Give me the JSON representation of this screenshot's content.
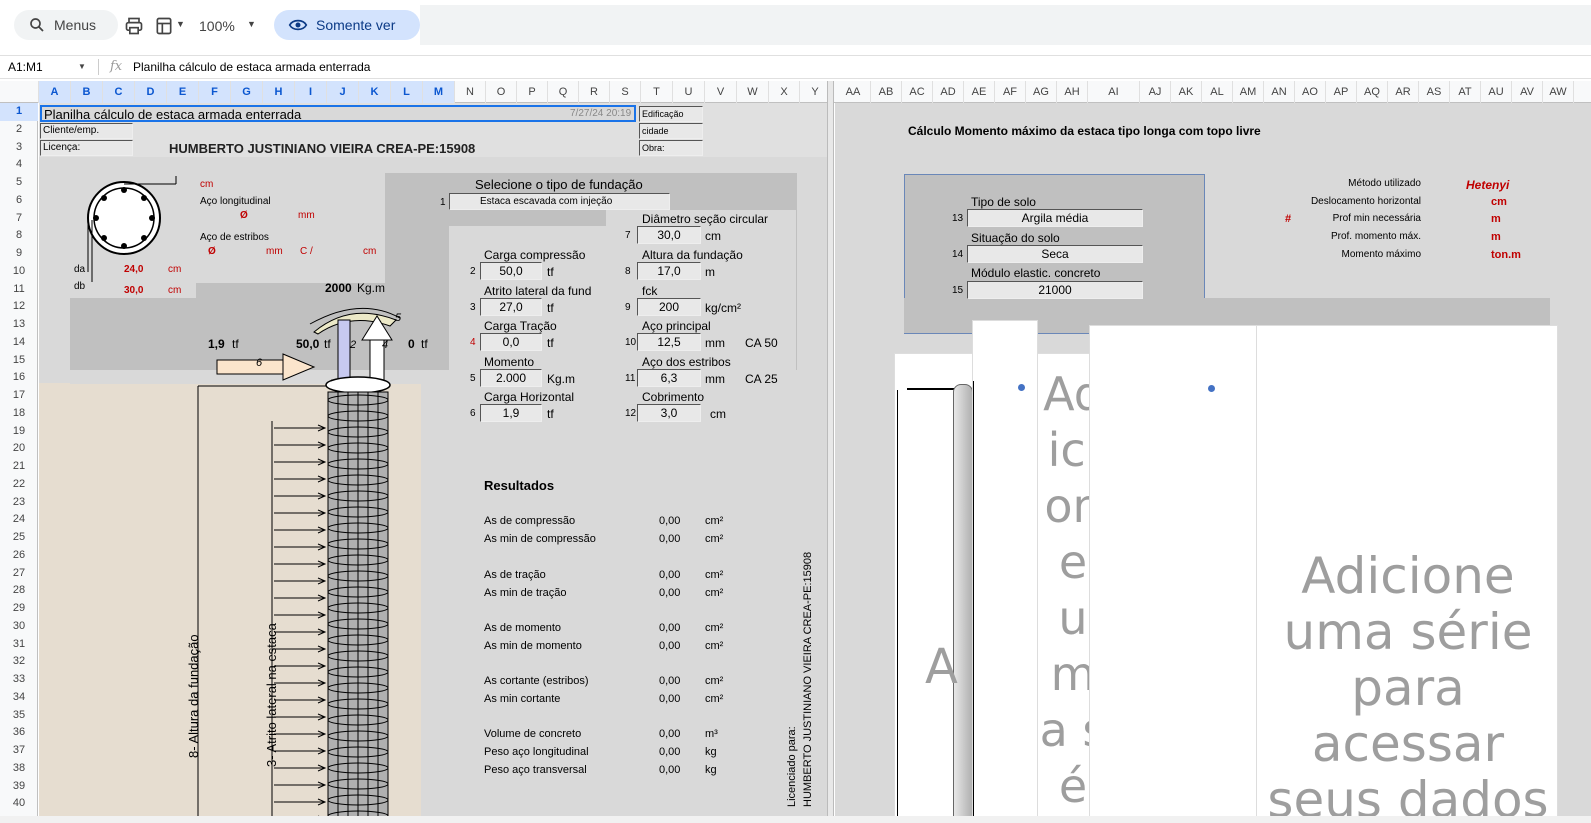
{
  "toolbar": {
    "search_label": "Menus",
    "zoom": "100%",
    "view_mode": "Somente ver"
  },
  "formula_bar": {
    "cell_ref": "A1:M1",
    "fx": "fx",
    "content": "Planilha cálculo de estaca armada enterrada"
  },
  "columns": [
    "A",
    "B",
    "C",
    "D",
    "E",
    "F",
    "G",
    "H",
    "I",
    "J",
    "K",
    "L",
    "M",
    "N",
    "O",
    "P",
    "Q",
    "R",
    "S",
    "T",
    "U",
    "V",
    "W",
    "X",
    "Y",
    "AA",
    "AB",
    "AC",
    "AD",
    "AE",
    "AF",
    "AG",
    "AH",
    "AI",
    "AJ",
    "AK",
    "AL",
    "AM",
    "AN",
    "AO",
    "AP",
    "AQ",
    "AR",
    "AS",
    "AT",
    "AU",
    "AV",
    "AW"
  ],
  "rows": [
    "1",
    "2",
    "3",
    "4",
    "5",
    "6",
    "7",
    "8",
    "9",
    "10",
    "11",
    "12",
    "13",
    "14",
    "15",
    "16",
    "17",
    "18",
    "19",
    "20",
    "21",
    "22",
    "23",
    "24",
    "25",
    "26",
    "27",
    "28",
    "29",
    "30",
    "31",
    "32",
    "33",
    "34",
    "35",
    "36",
    "37",
    "38",
    "39",
    "40"
  ],
  "sheet": {
    "title": "Planilha cálculo de estaca armada enterrada",
    "timestamp": "7/27/24 20:19",
    "edificacao": "Edificação",
    "cidade": "cidade",
    "obra": "Obra:",
    "cliente": "Cliente/emp.",
    "licenca": "Licença:",
    "licensee": "HUMBERTO JUSTINIANO VIEIRA  CREA-PE:15908",
    "section": {
      "cm": "cm",
      "aco_long": "Aço longitudinal",
      "phi1": "Ø",
      "mm1": "mm",
      "aco_estribos": "Aço de estribos",
      "phi2": "Ø",
      "mm2": "mm",
      "c": "C /",
      "cm2": "cm",
      "da": "da",
      "da_val": "24,0",
      "da_unit": "cm",
      "db": "db",
      "db_val": "30,0",
      "db_unit": "cm"
    },
    "foundation": {
      "header": "Selecione o tipo de fundação",
      "idx": "1",
      "type": "Estaca escavada com injeção"
    },
    "loads": [
      {
        "idx": "2",
        "label": "Carga compressão",
        "value": "50,0",
        "unit": "tf"
      },
      {
        "idx": "3",
        "label": "Atrito lateral da fund",
        "value": "27,0",
        "unit": "tf"
      },
      {
        "idx": "4",
        "label": "Carga Tração",
        "value": "0,0",
        "unit": "tf"
      },
      {
        "idx": "5",
        "label": "Momento",
        "value": "2.000",
        "unit": "Kg.m"
      },
      {
        "idx": "6",
        "label": "Carga Horizontal",
        "value": "1,9",
        "unit": "tf"
      }
    ],
    "params": [
      {
        "idx": "7",
        "label": "Diâmetro seção circular",
        "value": "30,0",
        "unit": "cm",
        "extra": ""
      },
      {
        "idx": "8",
        "label": "Altura da fundação",
        "value": "17,0",
        "unit": "m",
        "extra": ""
      },
      {
        "idx": "9",
        "label": "fck",
        "value": "200",
        "unit": "kg/cm²",
        "extra": ""
      },
      {
        "idx": "10",
        "label": "Aço principal",
        "value": "12,5",
        "unit": "mm",
        "extra": "CA    50"
      },
      {
        "idx": "11",
        "label": "Aço dos estribos",
        "value": "6,3",
        "unit": "mm",
        "extra": "CA 25"
      },
      {
        "idx": "12",
        "label": "Cobrimento",
        "value": "3,0",
        "unit": "cm",
        "extra": ""
      }
    ],
    "diagram": {
      "moment": "2000",
      "moment_unit": "Kg.m",
      "h_val": "1,9",
      "h_unit": "tf",
      "c_val": "50,0",
      "c_unit": "tf",
      "t_val": "0",
      "t_unit": "tf",
      "arrow2": "2",
      "arrow4": "4",
      "arrow5": "5",
      "arrow6": "6",
      "height_label": "8- Altura da fundação",
      "friction_label": "3- Atrito lateral na estaca"
    },
    "results": {
      "title": "Resultados",
      "items": [
        {
          "label": "As de compressão",
          "value": "0,00",
          "unit": "cm²"
        },
        {
          "label": "As min de compressão",
          "value": "0,00",
          "unit": "cm²"
        },
        {
          "label": "As de tração",
          "value": "0,00",
          "unit": "cm²"
        },
        {
          "label": "As min de tração",
          "value": "0,00",
          "unit": "cm²"
        },
        {
          "label": "As de momento",
          "value": "0,00",
          "unit": "cm²"
        },
        {
          "label": "As min de momento",
          "value": "0,00",
          "unit": "cm²"
        },
        {
          "label": "As cortante (estribos)",
          "value": "0,00",
          "unit": "cm²"
        },
        {
          "label": "As min cortante",
          "value": "0,00",
          "unit": "cm²"
        },
        {
          "label": "Volume de concreto",
          "value": "0,00",
          "unit": "m³"
        },
        {
          "label": "Peso aço longitudinal",
          "value": "0,00",
          "unit": "kg"
        },
        {
          "label": "Peso aço transversal",
          "value": "0,00",
          "unit": "kg"
        }
      ],
      "vertical_licensee": "HUMBERTO JUSTINIANO VIEIRA  CREA-PE:15908",
      "vertical_licenciado": "Licenciado para:"
    }
  },
  "right": {
    "title": "Cálculo Momento máximo da estaca tipo longa com topo livre",
    "solo_label": "Tipo de solo",
    "solo_idx": "13",
    "solo_value": "Argila média",
    "situacao_label": "Situação do solo",
    "situacao_idx": "14",
    "situacao_value": "Seca",
    "modulo_label": "Módulo elastic. concreto",
    "modulo_idx": "15",
    "modulo_value": "21000",
    "outputs": [
      {
        "label": "Método utilizado",
        "value": "Hetenyi",
        "flag": ""
      },
      {
        "label": "Deslocamento horizontal",
        "value": "cm",
        "flag": ""
      },
      {
        "label": "Prof min necessária",
        "value": "m",
        "flag": "#"
      },
      {
        "label": "Prof. momento máx.",
        "value": "m",
        "flag": ""
      },
      {
        "label": "Momento máximo",
        "value": "ton.m",
        "flag": ""
      }
    ],
    "chart_placeholder_big": "Adicione uma série para acessar seus dados",
    "chart_placeholder_narrow": "Adicione uma sé",
    "chart_placeholder_a": "A"
  }
}
